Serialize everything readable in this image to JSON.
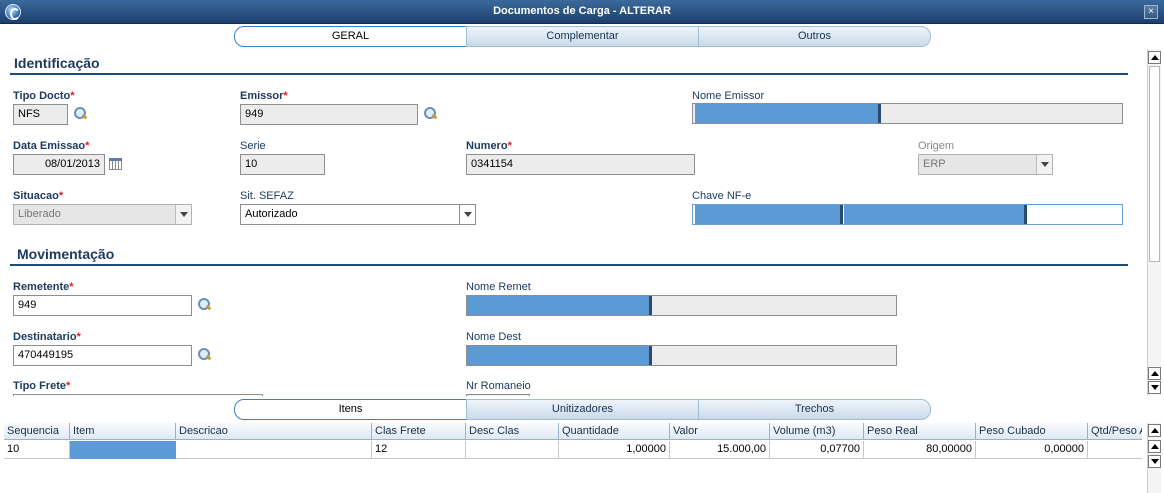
{
  "window": {
    "title": "Documentos de Carga - ALTERAR"
  },
  "top_tabs": [
    {
      "label": "GERAL"
    },
    {
      "label": "Complementar"
    },
    {
      "label": "Outros"
    }
  ],
  "identificacao": {
    "title": "Identificação",
    "tipo_docto": {
      "label": "Tipo Docto",
      "value": "NFS"
    },
    "emissor": {
      "label": "Emissor",
      "value": "949"
    },
    "nome_emissor": {
      "label": "Nome Emissor",
      "value": ""
    },
    "data_emissao": {
      "label": "Data Emissao",
      "value": "08/01/2013"
    },
    "serie": {
      "label": "Serie",
      "value": "10"
    },
    "numero": {
      "label": "Numero",
      "value": "0341154"
    },
    "origem": {
      "label": "Origem",
      "value": "ERP"
    },
    "situacao": {
      "label": "Situacao",
      "value": "Liberado"
    },
    "sit_sefaz": {
      "label": "Sit. SEFAZ",
      "value": "Autorizado"
    },
    "chave_nfe": {
      "label": "Chave NF-e",
      "value": ""
    }
  },
  "movimentacao": {
    "title": "Movimentação",
    "remetente": {
      "label": "Remetente",
      "value": "949"
    },
    "nome_remet": {
      "label": "Nome Remet",
      "value": ""
    },
    "destinatario": {
      "label": "Destinatario",
      "value": "470449195"
    },
    "nome_dest": {
      "label": "Nome Dest",
      "value": ""
    },
    "tipo_frete": {
      "label": "Tipo Frete"
    },
    "nr_romaneio": {
      "label": "Nr Romaneio"
    }
  },
  "required_mark": "*",
  "bottom_tabs": [
    {
      "label": "Itens"
    },
    {
      "label": "Unitizadores"
    },
    {
      "label": "Trechos"
    }
  ],
  "grid": {
    "columns": [
      "Sequencia",
      "Item",
      "Descricao",
      "Clas Frete",
      "Desc Clas",
      "Quantidade",
      "Valor",
      "Volume (m3)",
      "Peso Real",
      "Peso Cubado",
      "Qtd/Peso A"
    ],
    "rows": [
      [
        "10",
        "",
        "",
        "12",
        "",
        "1,00000",
        "15.000,00",
        "0,07700",
        "80,00000",
        "0,00000",
        ""
      ]
    ]
  },
  "colors": {
    "title_bar": "#1c3f6c",
    "section_line": "#1d4c7d",
    "redaction": "#5b9ad4",
    "required": "#e01d1d"
  },
  "icons": [
    "app-logo-icon",
    "close-icon",
    "search-icon",
    "calendar-icon",
    "chevron-down-icon",
    "scroll-up-icon",
    "scroll-down-icon"
  ]
}
